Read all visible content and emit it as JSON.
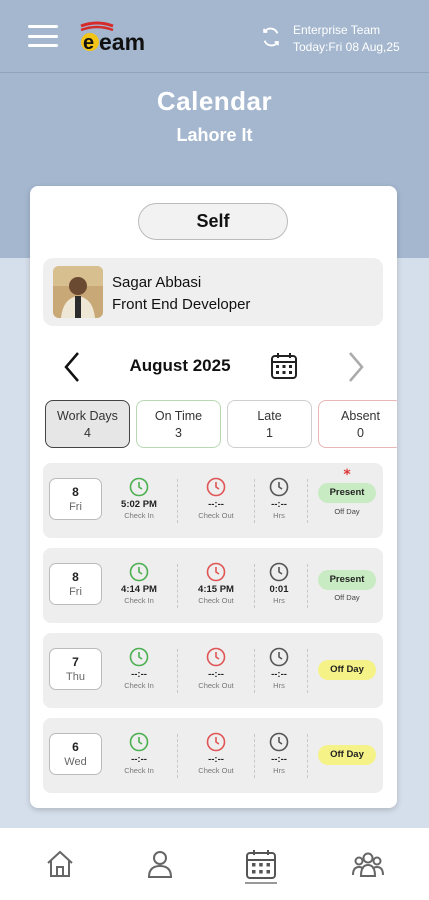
{
  "header": {
    "logo_alt": "eTeam",
    "team_name": "Enterprise Team",
    "today": "Today:Fri 08 Aug,25"
  },
  "page": {
    "title": "Calendar",
    "subtitle": "Lahore It"
  },
  "self_button": "Self",
  "profile": {
    "name": "Sagar Abbasi",
    "role": "Front End Developer"
  },
  "month_nav": {
    "month": "August 2025"
  },
  "stats": [
    {
      "label": "Work Days",
      "value": "4"
    },
    {
      "label": "On Time",
      "value": "3"
    },
    {
      "label": "Late",
      "value": "1"
    },
    {
      "label": "Absent",
      "value": "0"
    }
  ],
  "attendance": [
    {
      "day": "8",
      "weekday": "Fri",
      "check_in": "5:02 PM",
      "check_in_label": "Check In",
      "check_out": "--:--",
      "check_out_label": "Check Out",
      "hrs": "--:--",
      "hrs_label": "Hrs",
      "status": "Present",
      "note": "Off Day",
      "star": "*"
    },
    {
      "day": "8",
      "weekday": "Fri",
      "check_in": "4:14 PM",
      "check_in_label": "Check In",
      "check_out": "4:15 PM",
      "check_out_label": "Check Out",
      "hrs": "0:01",
      "hrs_label": "Hrs",
      "status": "Present",
      "note": "Off Day"
    },
    {
      "day": "7",
      "weekday": "Thu",
      "check_in": "--:--",
      "check_in_label": "Check In",
      "check_out": "--:--",
      "check_out_label": "Check Out",
      "hrs": "--:--",
      "hrs_label": "Hrs",
      "status": "Off Day"
    },
    {
      "day": "6",
      "weekday": "Wed",
      "check_in": "--:--",
      "check_in_label": "Check In",
      "check_out": "--:--",
      "check_out_label": "Check Out",
      "hrs": "--:--",
      "hrs_label": "Hrs",
      "status": "Off Day"
    }
  ],
  "colors": {
    "header_bg": "#a4b7cf",
    "page_bg": "#d5deeb",
    "check_in": "#4caf50",
    "check_out": "#e05555",
    "present_bg": "#c9ebc3",
    "offday_bg": "#f5f287"
  },
  "icons": {
    "menu": "hamburger-icon",
    "sync": "sync-icon",
    "prev": "chevron-left-icon",
    "next": "chevron-right-icon",
    "calendar": "calendar-icon",
    "nav": [
      "home-icon",
      "user-icon",
      "calendar-icon",
      "team-icon"
    ]
  }
}
